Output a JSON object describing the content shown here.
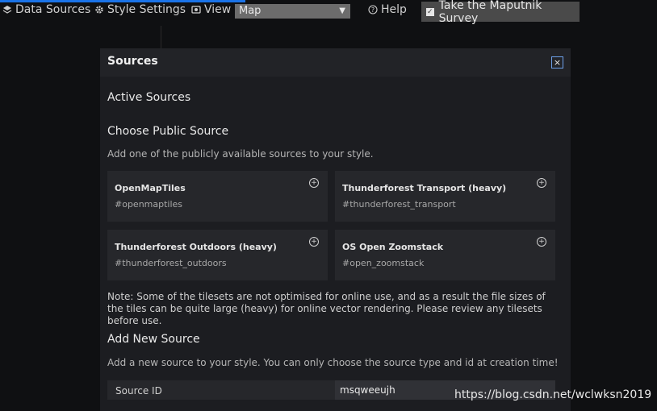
{
  "toolbar": {
    "data_sources": "Data Sources",
    "style_settings": "Style Settings",
    "view_label": "View",
    "view_value": "Map",
    "help": "Help",
    "survey": "Take the Maputnik Survey"
  },
  "modal": {
    "title": "Sources",
    "close": "×",
    "active_sources_title": "Active Sources",
    "public_title": "Choose Public Source",
    "public_desc": "Add one of the publicly available sources to your style.",
    "public_sources": [
      {
        "title": "OpenMapTiles",
        "id": "#openmaptiles"
      },
      {
        "title": "Thunderforest Transport (heavy)",
        "id": "#thunderforest_transport"
      },
      {
        "title": "Thunderforest Outdoors (heavy)",
        "id": "#thunderforest_outdoors"
      },
      {
        "title": "OS Open Zoomstack",
        "id": "#open_zoomstack"
      }
    ],
    "note": "Note: Some of the tilesets are not optimised for online use, and as a result the file sizes of the tiles can be quite large (heavy) for online vector rendering. Please review any tilesets before use.",
    "add_new_title": "Add New Source",
    "add_new_desc": "Add a new source to your style. You can only choose the source type and id at creation time!",
    "source_id_label": "Source ID",
    "source_id_value": "msqweeujh"
  },
  "watermark": "https://blog.csdn.net/wclwksn2019",
  "colors": {
    "accent": "#1a73e8",
    "modal_bg": "#1c1d21",
    "card_bg": "#26272b"
  }
}
